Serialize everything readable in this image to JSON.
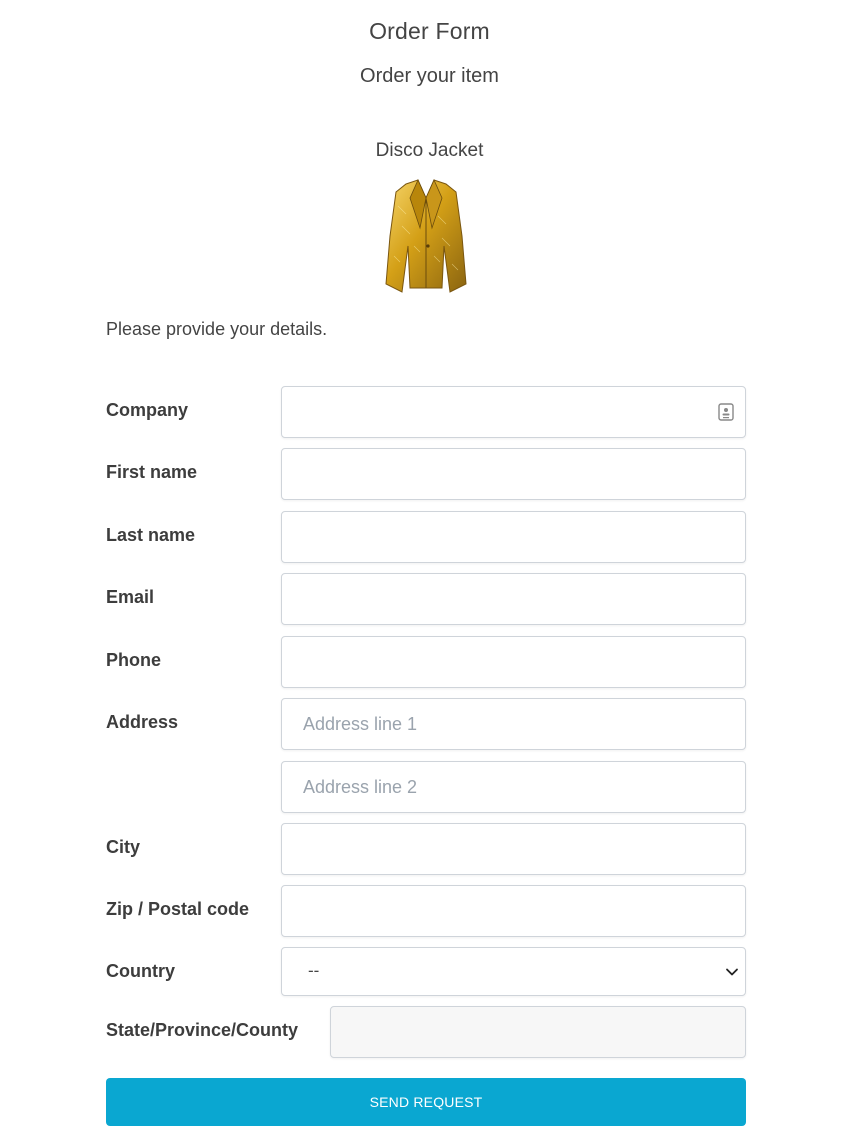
{
  "header": {
    "title": "Order Form",
    "subtitle": "Order your item"
  },
  "product": {
    "name": "Disco Jacket",
    "image_icon": "gold-jacket-image",
    "image_color": "#d4a017"
  },
  "intro_text": "Please provide your details.",
  "form": {
    "company": {
      "label": "Company",
      "value": "",
      "icon": "contact-card-autofill-icon"
    },
    "first_name": {
      "label": "First name",
      "value": ""
    },
    "last_name": {
      "label": "Last name",
      "value": ""
    },
    "email": {
      "label": "Email",
      "value": ""
    },
    "phone": {
      "label": "Phone",
      "value": ""
    },
    "address": {
      "label": "Address",
      "line1_placeholder": "Address line 1",
      "line2_placeholder": "Address line 2"
    },
    "city": {
      "label": "City",
      "value": ""
    },
    "zip": {
      "label": "Zip / Postal code",
      "value": ""
    },
    "country": {
      "label": "Country",
      "selected": "--",
      "icon": "chevron-down-icon"
    },
    "state": {
      "label": "State/Province/County",
      "value": ""
    },
    "submit_label": "SEND REQUEST"
  },
  "colors": {
    "button": "#0aa7d1",
    "button_text": "#ffffff",
    "label_text": "#3d3d3d",
    "placeholder": "#9aa3ad"
  }
}
